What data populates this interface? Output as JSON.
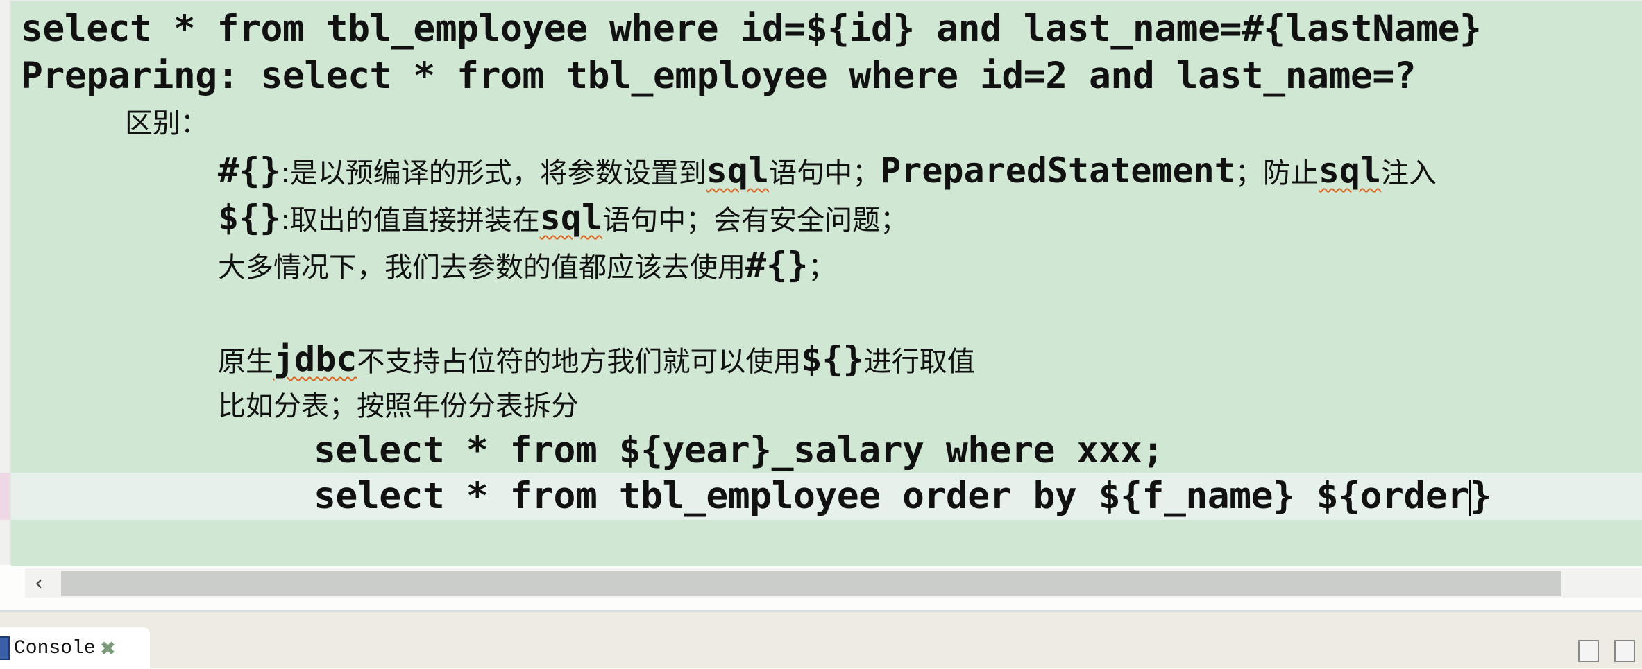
{
  "editor": {
    "lines": {
      "l1": "select * from tbl_employee where id=${id} and last_name=#{lastName}",
      "l2": "Preparing: select * from tbl_employee where id=2 and last_name=?",
      "l3": "区别：",
      "l4a": "#{}",
      "l4b": ":是以预编译的形式，将参数设置到",
      "l4c": "sql",
      "l4d": "语句中；",
      "l4e": "PreparedStatement",
      "l4f": "；防止",
      "l4g": "sql",
      "l4h": "注入",
      "l5a": "${}",
      "l5b": ":取出的值直接拼装在",
      "l5c": "sql",
      "l5d": "语句中；会有安全问题；",
      "l6a": "大多情况下，我们去参数的值都应该去使用",
      "l6b": "#{}",
      "l6c": "；",
      "l8a": "原生",
      "l8b": "jdbc",
      "l8c": "不支持占位符的地方我们就可以使用",
      "l8d": "${}",
      "l8e": "进行取值",
      "l9": "比如分表；按照年份分表拆分",
      "l10": "select * from ${year}_salary where xxx;",
      "l11a": "select * from tbl_employee order by ${f_name} ${order",
      "l11b": "}"
    }
  },
  "console_tab": {
    "label": "Console"
  }
}
